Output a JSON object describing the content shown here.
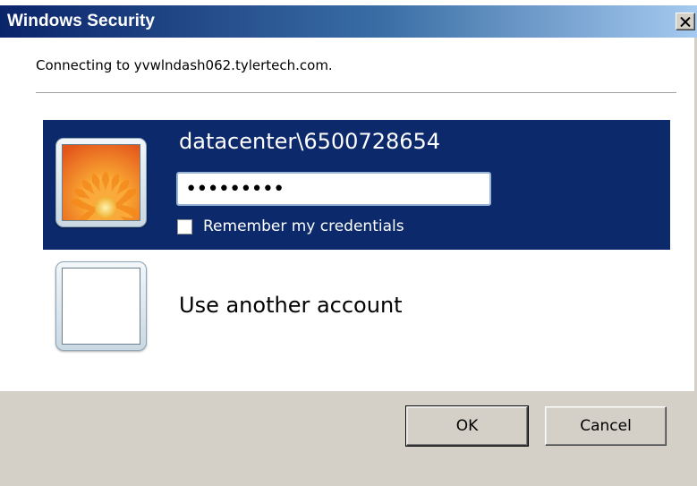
{
  "window": {
    "title": "Windows Security",
    "close_label": "✕"
  },
  "connecting_text": "Connecting to yvwlndash062.tylertech.com.",
  "selected_credential": {
    "username": "datacenter\\6500728654",
    "password_masked": "•••••••••",
    "remember_label": "Remember my credentials",
    "remember_checked": false,
    "avatar_icon": "flower-icon"
  },
  "other_account": {
    "label": "Use another account",
    "avatar_icon": "blank-avatar-icon"
  },
  "buttons": {
    "ok_label": "OK",
    "cancel_label": "Cancel"
  },
  "colors": {
    "selection": "#0c2a6b",
    "button_bar": "#d4d0c8",
    "title_gradient_start": "#0a246a"
  }
}
